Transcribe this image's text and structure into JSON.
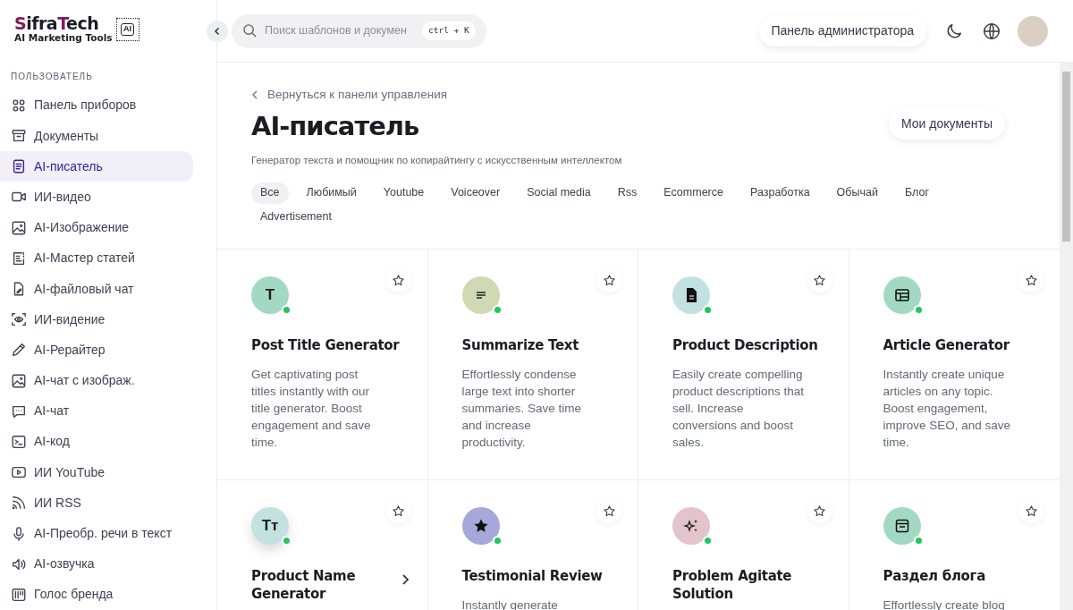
{
  "logo": {
    "name_parts": [
      {
        "text": "S",
        "accent": true
      },
      {
        "text": "ifra",
        "accent": false
      },
      {
        "text": "T",
        "accent": true
      },
      {
        "text": "ech",
        "accent": false
      }
    ],
    "tagline": "AI Marketing Tools",
    "chip_text": "AI"
  },
  "sidebar": {
    "section_title": "ПОЛЬЗОВАТЕЛЬ",
    "items": [
      {
        "label": "Панель приборов",
        "kind": "grid",
        "selected": false
      },
      {
        "label": "Документы",
        "kind": "archive",
        "selected": false
      },
      {
        "label": "AI-писатель",
        "kind": "doc",
        "selected": true
      },
      {
        "label": "ИИ-видео",
        "kind": "video",
        "selected": false
      },
      {
        "label": "AI-Изображение",
        "kind": "image",
        "selected": false
      },
      {
        "label": "AI-Мастер статей",
        "kind": "article",
        "selected": false
      },
      {
        "label": "AI-файловый чат",
        "kind": "file",
        "selected": false
      },
      {
        "label": "ИИ-видение",
        "kind": "vision",
        "selected": false
      },
      {
        "label": "AI-Рерайтер",
        "kind": "pencil",
        "selected": false
      },
      {
        "label": "AI-чат с изображ.",
        "kind": "image",
        "selected": false
      },
      {
        "label": "AI-чат",
        "kind": "chat",
        "selected": false
      },
      {
        "label": "AI-код",
        "kind": "terminal",
        "selected": false
      },
      {
        "label": "ИИ YouTube",
        "kind": "play",
        "selected": false
      },
      {
        "label": "ИИ RSS",
        "kind": "rss",
        "selected": false
      },
      {
        "label": "AI-Преобр. речи в текст",
        "kind": "mic",
        "selected": false
      },
      {
        "label": "AI-озвучка",
        "kind": "speaker",
        "selected": false
      },
      {
        "label": "Голос бренда",
        "kind": "brand",
        "selected": false
      }
    ]
  },
  "header": {
    "search": {
      "placeholder": "Поиск шаблонов и докумен",
      "shortcut": "ctrl + K"
    },
    "admin_button": "Панель администратора"
  },
  "page": {
    "back_link": "Вернуться к панели управления",
    "title": "AI-писатель",
    "subtitle": "Генератор текста и помощник по копирайтингу с искусственным интеллектом",
    "my_docs_button": "Мои документы",
    "filters": [
      {
        "label": "Все",
        "selected": true
      },
      {
        "label": "Любимый",
        "selected": false
      },
      {
        "label": "Youtube",
        "selected": false
      },
      {
        "label": "Voiceover",
        "selected": false
      },
      {
        "label": "Social media",
        "selected": false
      },
      {
        "label": "Rss",
        "selected": false
      },
      {
        "label": "Ecommerce",
        "selected": false
      },
      {
        "label": "Разработка",
        "selected": false
      },
      {
        "label": "Обычай",
        "selected": false
      },
      {
        "label": "Блог",
        "selected": false
      },
      {
        "label": "Advertisement",
        "selected": false
      }
    ]
  },
  "templates": [
    {
      "title": "Post Title Generator",
      "description": "Get captivating post titles instantly with our title generator. Boost engagement and save time.",
      "icon": {
        "kind": "letter",
        "text": "T"
      },
      "color": "#a3d9c3",
      "active": true,
      "hovered": false,
      "favorite": false
    },
    {
      "title": "Summarize Text",
      "description": "Effortlessly condense large text into shorter summaries. Save time and increase productivity.",
      "icon": {
        "kind": "lines"
      },
      "color": "#cfdab3",
      "active": true,
      "hovered": false,
      "favorite": false
    },
    {
      "title": "Product Description",
      "description": "Easily create compelling product descriptions that sell. Increase conversions and boost sales.",
      "icon": {
        "kind": "file"
      },
      "color": "#c3e1e1",
      "active": true,
      "hovered": false,
      "favorite": false
    },
    {
      "title": "Article Generator",
      "description": "Instantly create unique articles on any topic. Boost engagement, improve SEO, and save time.",
      "icon": {
        "kind": "calendar"
      },
      "color": "#a3d9c3",
      "active": true,
      "hovered": false,
      "favorite": false
    },
    {
      "title": "Product Name Generator",
      "icon": {
        "kind": "letter",
        "text": "Tт"
      },
      "color": "#c3e1e1",
      "active": true,
      "hovered": true,
      "favorite": false
    },
    {
      "title": "Testimonial Review",
      "description": "Instantly generate",
      "icon": {
        "kind": "star"
      },
      "color": "#a5a8d8",
      "active": true,
      "hovered": false,
      "favorite": false
    },
    {
      "title": "Problem Agitate Solution",
      "icon": {
        "kind": "sparkle"
      },
      "color": "#e3c3cc",
      "active": true,
      "hovered": false,
      "favorite": false
    },
    {
      "title": "Раздел блога",
      "description": "Effortlessly create blog",
      "icon": {
        "kind": "panel"
      },
      "color": "#a3d9c3",
      "active": true,
      "hovered": false,
      "favorite": false
    }
  ]
}
